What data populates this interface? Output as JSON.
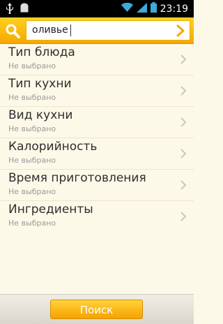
{
  "status_bar": {
    "time": "23:19",
    "icons": [
      "usb-icon",
      "android-debug-icon",
      "wifi-icon",
      "signal-icon",
      "battery-icon"
    ]
  },
  "search": {
    "value": "оливье",
    "search_icon": "search-icon",
    "submit_icon": "chevron-right-icon"
  },
  "filters": [
    {
      "label": "Тип блюда",
      "value": "Не выбрано"
    },
    {
      "label": "Тип кухни",
      "value": "Не выбрано"
    },
    {
      "label": "Вид кухни",
      "value": "Не выбрано"
    },
    {
      "label": "Калорийность",
      "value": "Не выбрано"
    },
    {
      "label": "Время приготовления",
      "value": "Не выбрано"
    },
    {
      "label": "Ингредиенты",
      "value": "Не выбрано"
    }
  ],
  "footer": {
    "search_button_label": "Поиск"
  },
  "colors": {
    "accent": "#f6a800",
    "background": "#fdf9e8"
  }
}
